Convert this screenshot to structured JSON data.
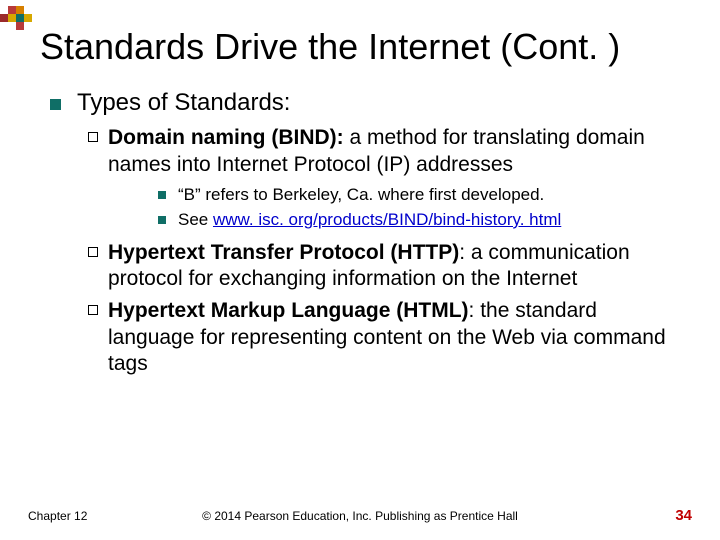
{
  "slide": {
    "title": "Standards Drive the Internet (Cont. )",
    "heading": "Types of Standards:",
    "items": [
      {
        "label_bold": "Domain naming (BIND):",
        "label_rest": " a method for translating domain names into Internet Protocol (IP) addresses",
        "sub": [
          {
            "text": "“B” refers to Berkeley, Ca. where first developed.",
            "link": ""
          },
          {
            "text": "See ",
            "link": "www. isc. org/products/BIND/bind-history. html"
          }
        ]
      },
      {
        "label_bold": "Hypertext Transfer Protocol (HTTP)",
        "label_rest": ": a communication protocol for exchanging information on the Internet",
        "sub": []
      },
      {
        "label_bold": "Hypertext Markup Language (HTML)",
        "label_rest": ": the standard language for representing content on the Web via command tags",
        "sub": []
      }
    ]
  },
  "footer": {
    "chapter": "Chapter 12",
    "copyright": "© 2014 Pearson Education, Inc. Publishing as Prentice Hall",
    "page": "34"
  }
}
